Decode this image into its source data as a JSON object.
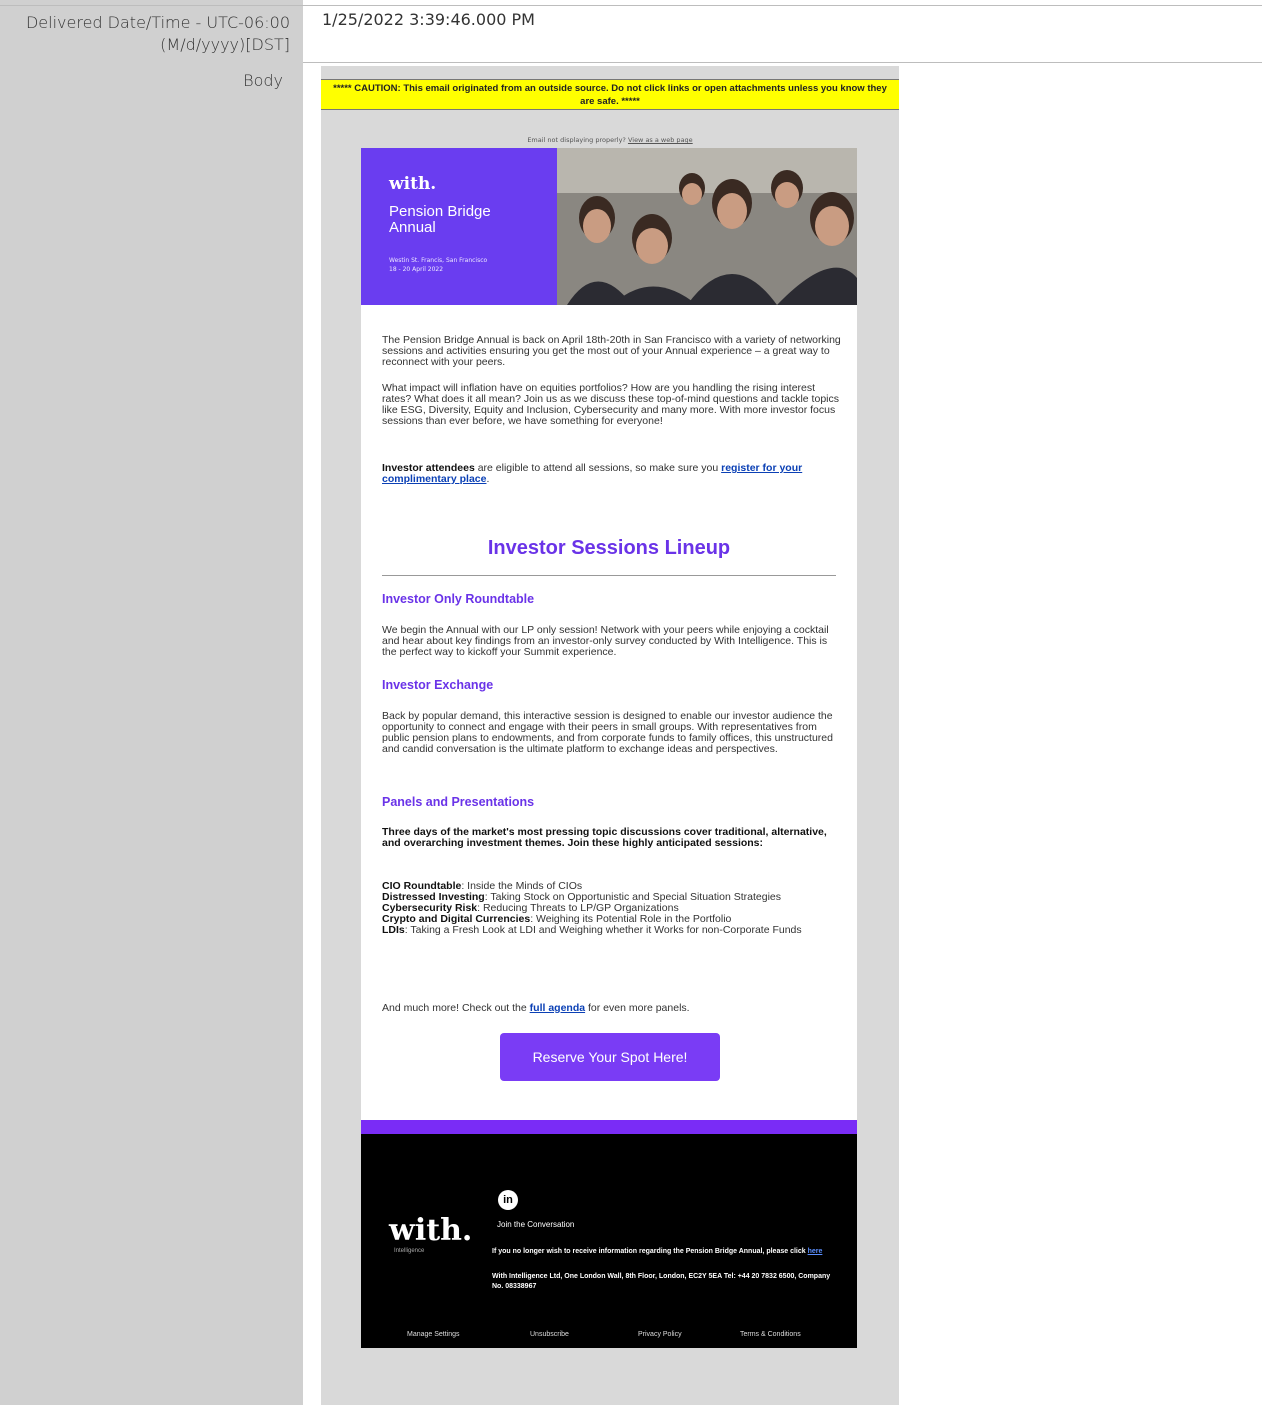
{
  "record": {
    "delivered_label": "Delivered Date/Time - UTC-06:00 (M/d/yyyy)[DST]",
    "delivered_value": "1/25/2022 3:39:46.000 PM",
    "body_label": "Body"
  },
  "email": {
    "caution_text": "***** CAUTION: This email originated from an outside source. Do not click links or open attachments unless you know they are safe. *****",
    "view_prefix": "Email not displaying properly?",
    "view_link": "View as a web page",
    "hero": {
      "logo": "with.",
      "title": "Pension Bridge Annual",
      "location": "Westin St. Francis, San Francisco",
      "dates": "18 - 20 April 2022"
    },
    "intro_p1": "The Pension Bridge Annual is back on April 18th-20th in San Francisco with a variety of networking sessions and activities ensuring you get the most out of your Annual experience – a great way to reconnect with your peers.",
    "intro_p2": "What impact will inflation have on equities portfolios? How are you handling the rising interest rates? What does it all mean? Join us as we discuss these top-of-mind questions and tackle topics like ESG, Diversity, Equity and Inclusion, Cybersecurity and many more. With more investor focus sessions than ever before, we have something for everyone!",
    "investor_bold": "Investor attendees",
    "investor_mid": " are eligible to attend all sessions, so make sure you ",
    "register_link": "register for your complimentary place",
    "lineup_heading": "Investor Sessions Lineup",
    "sections": [
      {
        "title": "Investor Only Roundtable",
        "text": "We begin the Annual with our LP only session! Network with your peers while enjoying a cocktail and hear about key findings from an investor-only survey conducted by With Intelligence. This is the perfect way to kickoff your Summit experience."
      },
      {
        "title": "Investor Exchange",
        "text": "Back by popular demand, this interactive session is designed to enable our investor audience the opportunity to connect and engage with their peers in small groups. With representatives from public pension plans to endowments, and from corporate funds to family offices, this unstructured and candid conversation is the ultimate platform to exchange ideas and perspectives."
      },
      {
        "title": "Panels and Presentations",
        "text": "Three days of the market's most pressing topic discussions cover traditional, alternative, and overarching investment themes. Join these highly anticipated sessions:"
      }
    ],
    "session_items": [
      {
        "name": "CIO Roundtable",
        "desc": ": Inside the Minds of CIOs"
      },
      {
        "name": "Distressed Investing",
        "desc": ": Taking Stock on Opportunistic and Special Situation Strategies"
      },
      {
        "name": "Cybersecurity Risk",
        "desc": ": Reducing Threats to LP/GP Organizations"
      },
      {
        "name": "Crypto and Digital Currencies",
        "desc": ": Weighing its Potential Role in the Portfolio"
      },
      {
        "name": "LDIs",
        "desc": ": Taking a Fresh Look at LDI and Weighing whether it Works for non-Corporate Funds"
      }
    ],
    "more_prefix": "And much more! Check out the ",
    "agenda_link": "full agenda",
    "more_suffix": " for even more panels.",
    "cta_label": "Reserve Your Spot Here!",
    "footer": {
      "logo": "with.",
      "logo_sub": "Intelligence",
      "linkedin": "in",
      "join": "Join the Conversation",
      "unsub_text": "If you no longer wish to receive information regarding the Pension Bridge Annual, please click ",
      "unsub_link": "here",
      "address": "With Intelligence Ltd, One London Wall, 8th Floor, London, EC2Y 5EA Tel: +44 20 7832 6500, Company No. 08338967",
      "nav": [
        "Manage Settings",
        "Unsubscribe",
        "Privacy Policy",
        "Terms & Conditions"
      ]
    }
  }
}
